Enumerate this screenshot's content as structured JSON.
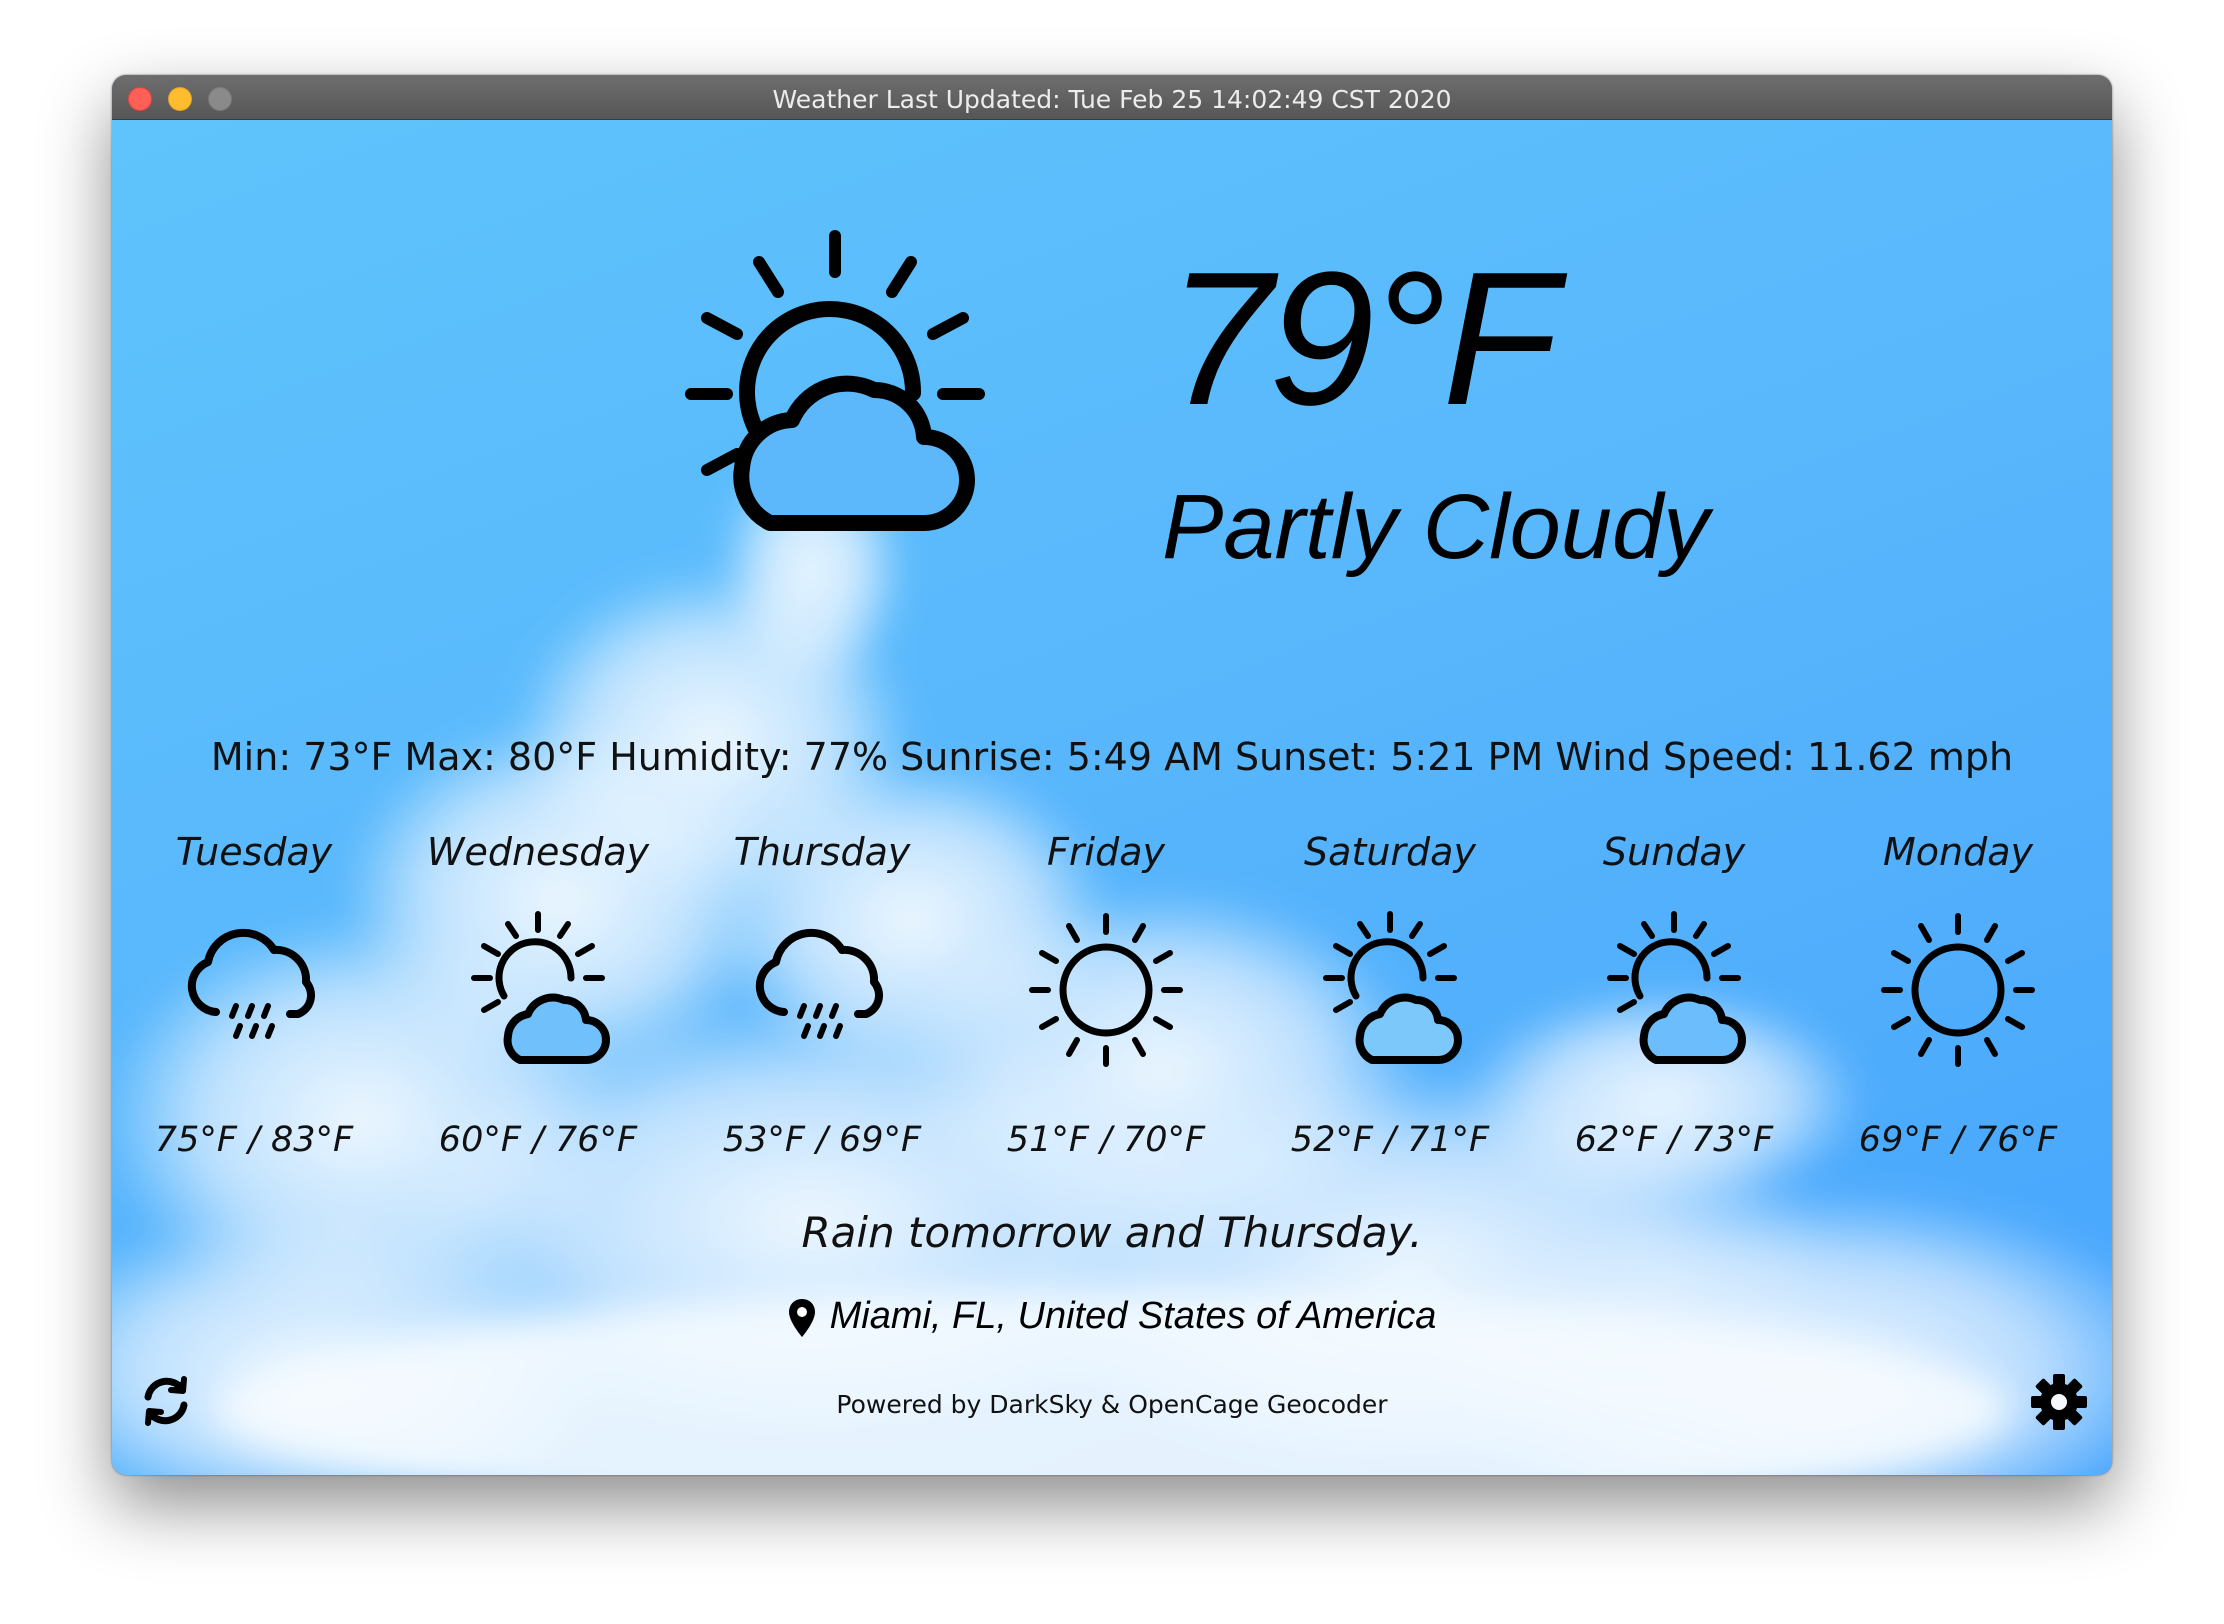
{
  "window": {
    "title": "Weather Last Updated: Tue Feb 25 14:02:49 CST 2020"
  },
  "current": {
    "temperature": "79°F",
    "condition": "Partly Cloudy",
    "icon": "partly-cloudy-icon",
    "details": "Min: 73°F Max: 80°F Humidity: 77% Sunrise: 5:49 AM Sunset: 5:21 PM Wind Speed: 11.62 mph"
  },
  "forecast": [
    {
      "day": "Tuesday",
      "temps": "75°F / 83°F",
      "icon": "rain-icon"
    },
    {
      "day": "Wednesday",
      "temps": "60°F / 76°F",
      "icon": "partly-cloudy-icon"
    },
    {
      "day": "Thursday",
      "temps": "53°F / 69°F",
      "icon": "rain-icon"
    },
    {
      "day": "Friday",
      "temps": "51°F / 70°F",
      "icon": "clear-day-icon"
    },
    {
      "day": "Saturday",
      "temps": "52°F / 71°F",
      "icon": "partly-cloudy-icon"
    },
    {
      "day": "Sunday",
      "temps": "62°F / 73°F",
      "icon": "partly-cloudy-icon"
    },
    {
      "day": "Monday",
      "temps": "69°F / 76°F",
      "icon": "clear-day-icon"
    }
  ],
  "summary": "Rain tomorrow and Thursday.",
  "location": "Miami, FL, United States of America",
  "footer": {
    "powered_by": "Powered by DarkSky & OpenCage Geocoder"
  },
  "icons": {
    "refresh": "refresh-icon",
    "settings": "gear-icon",
    "location": "map-pin-icon"
  },
  "colors": {
    "sky": "#59b7fc",
    "titlebar": "#5f5f5f",
    "close": "#fe5f57",
    "minimize": "#febc2e"
  }
}
